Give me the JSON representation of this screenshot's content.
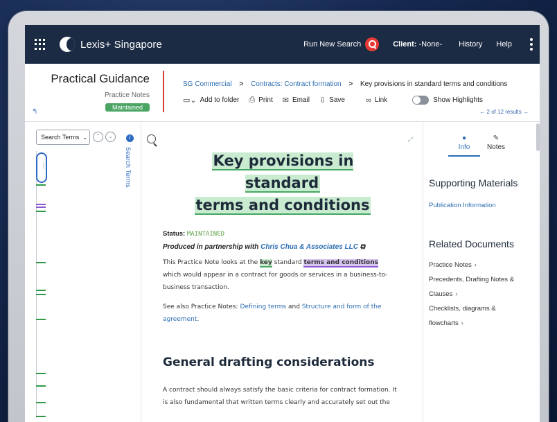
{
  "topbar": {
    "brand": "Lexis+ Singapore",
    "run_search": "Run New Search",
    "client_label": "Client:",
    "client_value": "-None-",
    "history": "History",
    "help": "Help"
  },
  "header": {
    "title": "Practical Guidance",
    "subtitle": "Practice Notes",
    "badge": "Maintained",
    "breadcrumb": [
      "SG Commercial",
      "Contracts: Contract formation",
      "Key provisions in standard terms and conditions"
    ],
    "tools": {
      "add_to_folder": "Add to folder",
      "print": "Print",
      "email": "Email",
      "save": "Save",
      "link": "Link",
      "show_highlights": "Show Highlights"
    },
    "results": "2 of 12 results"
  },
  "left": {
    "select_value": "Search Terms",
    "vertical_label": "Search Terms",
    "colors": {
      "green": "#2e9a48",
      "purple": "#8b5ad1",
      "thumb": "#2b6ac4"
    }
  },
  "doc": {
    "title_line1": "Key provisions in standard",
    "title_line2": "terms and conditions",
    "status_label": "Status:",
    "status_value": "MAINTAINED",
    "partner_prefix": "Produced in partnership with",
    "partner_name": "Chris Chua & Associates LLC",
    "p1_a": "This Practice Note looks at the",
    "p1_key": "key",
    "p1_b": "standard",
    "p1_tc": "terms and conditions",
    "p1_c": "which would appear in a contract for goods or services in a business-to-business transaction.",
    "p2_a": "See also Practice Notes:",
    "p2_link1": "Defining terms",
    "p2_and": "and",
    "p2_link2": "Structure and form of the agreement",
    "p2_end": ".",
    "heading2": "General drafting considerations",
    "p3": "A contract should always satisfy the basic criteria for contract formation. It is also fundamental that written terms clearly and accurately set out the"
  },
  "right": {
    "tab_info": "Info",
    "tab_notes": "Notes",
    "supporting": "Supporting Materials",
    "pub_info": "Publication Information",
    "related": "Related Documents",
    "items": [
      "Practice Notes",
      "Precedents, Drafting Notes &",
      "Clauses",
      "Checklists, diagrams &",
      "flowcharts"
    ]
  }
}
